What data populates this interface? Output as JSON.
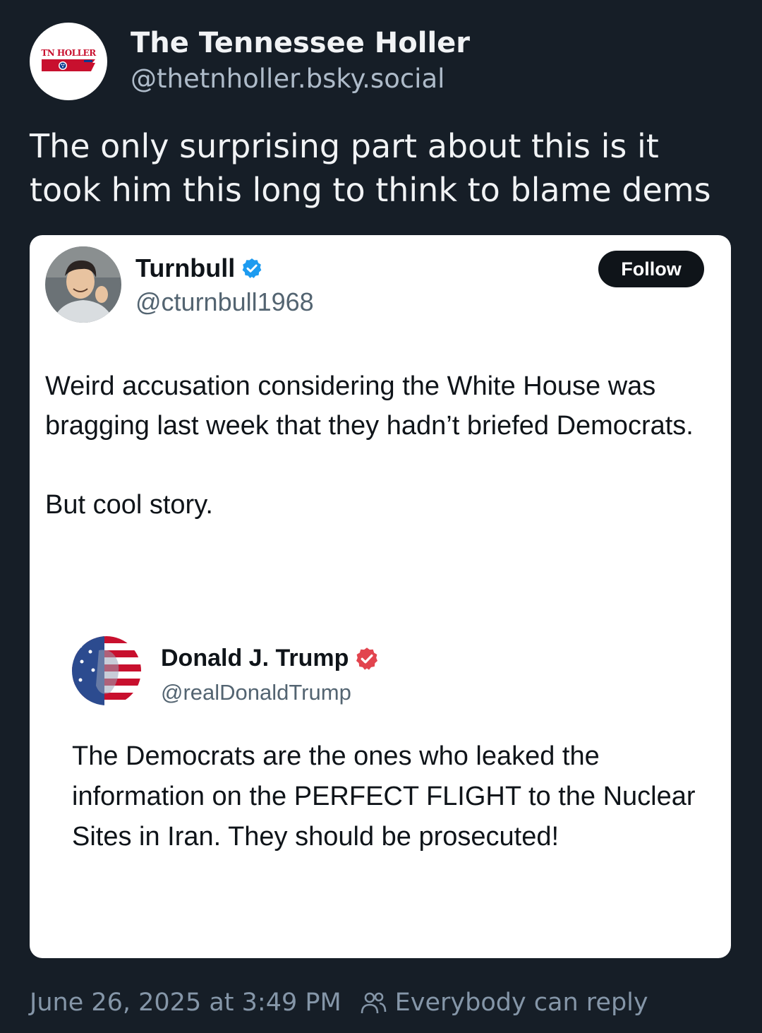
{
  "post": {
    "author_name": "The Tennessee Holler",
    "author_handle": "@thetnholler.bsky.social",
    "avatar_text": "TN HOLLER",
    "text": "The only surprising part about this is it took him this long to think to blame dems"
  },
  "embed": {
    "name": "Turnbull",
    "handle": "@cturnbull1968",
    "follow_label": "Follow",
    "paragraphs": [
      "Weird accusation considering the White House was bragging last week that they hadn’t briefed Democrats.",
      "But cool story."
    ],
    "quoted": {
      "name": "Donald J. Trump",
      "handle": "@realDonaldTrump",
      "text": "The Democrats are the ones who leaked the information on the PERFECT FLIGHT to the Nuclear Sites in Iran. They should be prosecuted!"
    }
  },
  "footer": {
    "timestamp": "June 26, 2025 at 3:49 PM",
    "reply_setting": "Everybody can reply"
  },
  "icons": {
    "verified_blue": "verified-badge-icon",
    "verified_red": "verified-badge-icon",
    "people": "people-icon"
  },
  "colors": {
    "background": "#161e27",
    "muted": "#8596a8",
    "twitter_blue": "#1d9bf0",
    "truth_red": "#e2444e"
  }
}
